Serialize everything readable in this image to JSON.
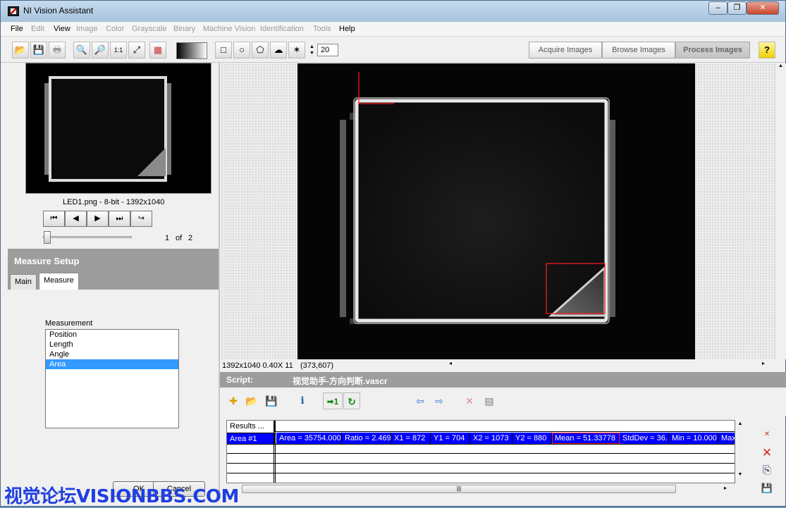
{
  "window": {
    "title": "NI Vision Assistant",
    "minimize": "‒",
    "maximize": "❐",
    "close": "✕"
  },
  "menu": [
    {
      "label": "File",
      "enabled": true
    },
    {
      "label": "Edit",
      "enabled": false
    },
    {
      "label": "View",
      "enabled": true
    },
    {
      "label": "Image",
      "enabled": false
    },
    {
      "label": "Color",
      "enabled": false
    },
    {
      "label": "Grayscale",
      "enabled": false
    },
    {
      "label": "Binary",
      "enabled": false
    },
    {
      "label": "Machine Vision",
      "enabled": false
    },
    {
      "label": "Identification",
      "enabled": false
    },
    {
      "label": "Tools",
      "enabled": false
    },
    {
      "label": "Help",
      "enabled": true
    }
  ],
  "toolbar": {
    "open_icon": "📂",
    "save_icon": "💾",
    "print_icon": "🖶",
    "zoom_in": "🔍",
    "zoom_out": "🔎",
    "zoom_1to1": "1:1",
    "zoom_fit": "⤢",
    "lut_icon": "▦",
    "rect_tool": "□",
    "oval_tool": "○",
    "poly_tool": "⬠",
    "free_tool": "☁",
    "wand_tool": "✶",
    "line_width": "20",
    "modes": {
      "acquire": "Acquire Images",
      "browse": "Browse Images",
      "process": "Process Images"
    },
    "help": "?"
  },
  "browser": {
    "image_info": "LED1.png - 8-bit - 1392x1040",
    "nav": {
      "first": "⏮",
      "prev": "◀",
      "next": "▶",
      "last": "⏭",
      "return": "↪"
    },
    "page_current": "1",
    "page_of": "of",
    "page_total": "2"
  },
  "measure_setup": {
    "title": "Measure Setup",
    "tabs": [
      "Main",
      "Measure"
    ],
    "active_tab": "Measure",
    "measurement_label": "Measurement",
    "options": [
      "Position",
      "Length",
      "Angle",
      "Area"
    ],
    "selected": "Area",
    "ok": "OK",
    "cancel": "Cancel"
  },
  "image_status": {
    "size_zoom": "1392x1040 0.40X 11",
    "coords": "(373,607)"
  },
  "script": {
    "label": "Script:",
    "filename": "视觉助手-方向判断.vascr",
    "icons": {
      "new": "✚",
      "open": "📂",
      "save": "💾",
      "info": "i",
      "run_once": "➡1",
      "run_loop": "↻",
      "back": "⇦",
      "forward": "⇨",
      "delete": "✕",
      "props": "▤"
    }
  },
  "results": {
    "header": "Results ...",
    "row_label": "Area #1",
    "values": [
      "Area = 35754.000",
      "Ratio = 2.469",
      "X1 = 872",
      "Y1 = 704",
      "X2 = 1073",
      "Y2 = 880",
      "Mean = 51.33778",
      "StdDev = 36.",
      "Min = 10.000",
      "Max"
    ],
    "side_icons": {
      "clear_sel": "✕",
      "delete": "✕",
      "copy": "⎘",
      "save": "💾"
    }
  },
  "watermark": "视觉论坛VISIONBBS.COM"
}
